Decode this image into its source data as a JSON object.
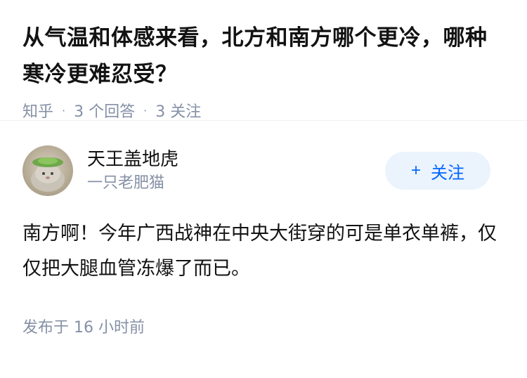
{
  "question": {
    "title": "从气温和体感来看，北方和南方哪个更冷，哪种寒冷更难忍受？",
    "source": "知乎",
    "answers_count": "3 个回答",
    "followers_count": "3 关注"
  },
  "answer": {
    "author_name": "天王盖地虎",
    "author_bio": "一只老肥猫",
    "follow_label": "关注",
    "follow_icon": "plus-icon",
    "content": "南方啊！今年广西战神在中央大街穿的可是单衣单裤，仅仅把大腿血管冻爆了而已。",
    "time": "发布于 16 小时前"
  },
  "colors": {
    "accent": "#0066ff",
    "button_bg": "#ebf3fd",
    "meta_text": "#8590a6",
    "main_text": "#121212"
  }
}
